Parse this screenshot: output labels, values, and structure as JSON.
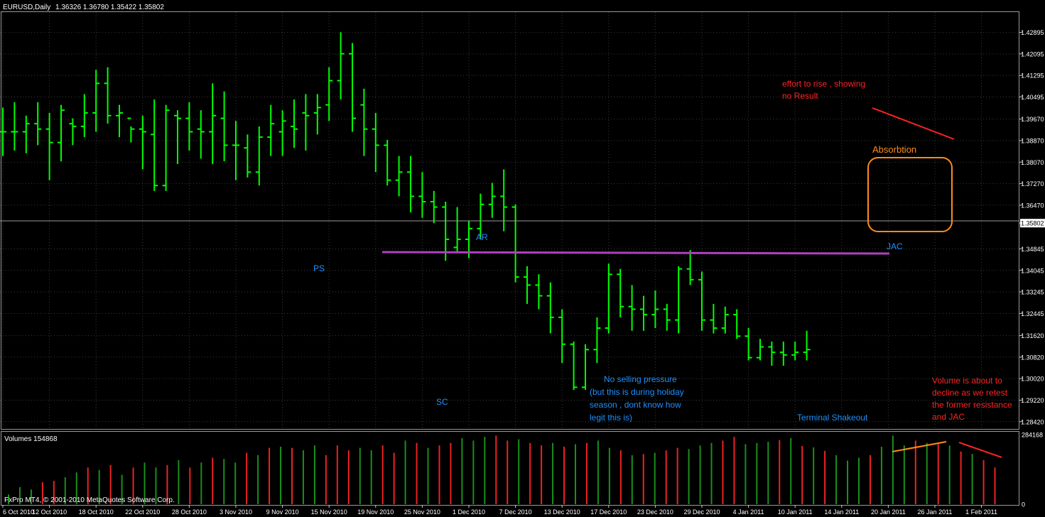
{
  "chart_data": {
    "type": "ohlc",
    "header": {
      "symbol": "EURUSD,Daily",
      "ohlc_text": "1.36326 1.36780 1.35422 1.35802"
    },
    "current_price_label": "1.35802",
    "price_axis": {
      "ylim": [
        1.2815,
        1.4365
      ],
      "ticks": [
        "1.42895",
        "1.42095",
        "1.41295",
        "1.40495",
        "1.39670",
        "1.38870",
        "1.38070",
        "1.37270",
        "1.36470",
        "1.35802",
        "1.34845",
        "1.34045",
        "1.33245",
        "1.32445",
        "1.31620",
        "1.30820",
        "1.30020",
        "1.29220",
        "1.28420"
      ]
    },
    "date_ticks": [
      {
        "index": 0,
        "label": "6 Oct 2010"
      },
      {
        "index": 4,
        "label": "12 Oct 2010"
      },
      {
        "index": 8,
        "label": "18 Oct 2010"
      },
      {
        "index": 12,
        "label": "22 Oct 2010"
      },
      {
        "index": 16,
        "label": "28 Oct 2010"
      },
      {
        "index": 20,
        "label": "3 Nov 2010"
      },
      {
        "index": 24,
        "label": "9 Nov 2010"
      },
      {
        "index": 28,
        "label": "15 Nov 2010"
      },
      {
        "index": 32,
        "label": "19 Nov 2010"
      },
      {
        "index": 36,
        "label": "25 Nov 2010"
      },
      {
        "index": 40,
        "label": "1 Dec 2010"
      },
      {
        "index": 44,
        "label": "7 Dec 2010"
      },
      {
        "index": 48,
        "label": "13 Dec 2010"
      },
      {
        "index": 52,
        "label": "17 Dec 2010"
      },
      {
        "index": 56,
        "label": "23 Dec 2010"
      },
      {
        "index": 60,
        "label": "29 Dec 2010"
      },
      {
        "index": 64,
        "label": "4 Jan 2011"
      },
      {
        "index": 68,
        "label": "10 Jan 2011"
      },
      {
        "index": 72,
        "label": "14 Jan 2011"
      },
      {
        "index": 76,
        "label": "20 Jan 2011"
      },
      {
        "index": 80,
        "label": "26 Jan 2011"
      },
      {
        "index": 84,
        "label": "1 Feb 2011"
      }
    ],
    "bars": [
      {
        "o": 1.392,
        "h": 1.401,
        "l": 1.383,
        "c": 1.392
      },
      {
        "o": 1.392,
        "h": 1.403,
        "l": 1.385,
        "c": 1.392
      },
      {
        "o": 1.392,
        "h": 1.398,
        "l": 1.384,
        "c": 1.395
      },
      {
        "o": 1.395,
        "h": 1.403,
        "l": 1.387,
        "c": 1.393
      },
      {
        "o": 1.393,
        "h": 1.399,
        "l": 1.374,
        "c": 1.388
      },
      {
        "o": 1.388,
        "h": 1.402,
        "l": 1.381,
        "c": 1.4
      },
      {
        "o": 1.395,
        "h": 1.397,
        "l": 1.387,
        "c": 1.394
      },
      {
        "o": 1.394,
        "h": 1.406,
        "l": 1.39,
        "c": 1.399
      },
      {
        "o": 1.399,
        "h": 1.415,
        "l": 1.392,
        "c": 1.41
      },
      {
        "o": 1.41,
        "h": 1.416,
        "l": 1.395,
        "c": 1.398
      },
      {
        "o": 1.398,
        "h": 1.402,
        "l": 1.39,
        "c": 1.399
      },
      {
        "o": 1.397,
        "h": 1.394,
        "l": 1.388,
        "c": 1.393
      },
      {
        "o": 1.393,
        "h": 1.398,
        "l": 1.378,
        "c": 1.392
      },
      {
        "o": 1.391,
        "h": 1.404,
        "l": 1.37,
        "c": 1.372
      },
      {
        "o": 1.372,
        "h": 1.402,
        "l": 1.37,
        "c": 1.4
      },
      {
        "o": 1.398,
        "h": 1.4,
        "l": 1.38,
        "c": 1.397
      },
      {
        "o": 1.397,
        "h": 1.403,
        "l": 1.385,
        "c": 1.392
      },
      {
        "o": 1.393,
        "h": 1.4,
        "l": 1.382,
        "c": 1.392
      },
      {
        "o": 1.392,
        "h": 1.41,
        "l": 1.38,
        "c": 1.398
      },
      {
        "o": 1.397,
        "h": 1.407,
        "l": 1.381,
        "c": 1.387
      },
      {
        "o": 1.387,
        "h": 1.396,
        "l": 1.374,
        "c": 1.387
      },
      {
        "o": 1.386,
        "h": 1.391,
        "l": 1.375,
        "c": 1.377
      },
      {
        "o": 1.377,
        "h": 1.394,
        "l": 1.372,
        "c": 1.39
      },
      {
        "o": 1.39,
        "h": 1.402,
        "l": 1.383,
        "c": 1.395
      },
      {
        "o": 1.392,
        "h": 1.4,
        "l": 1.383,
        "c": 1.396
      },
      {
        "o": 1.394,
        "h": 1.404,
        "l": 1.386,
        "c": 1.393
      },
      {
        "o": 1.399,
        "h": 1.406,
        "l": 1.385,
        "c": 1.398
      },
      {
        "o": 1.399,
        "h": 1.406,
        "l": 1.391,
        "c": 1.401
      },
      {
        "o": 1.402,
        "h": 1.416,
        "l": 1.396,
        "c": 1.411
      },
      {
        "o": 1.411,
        "h": 1.429,
        "l": 1.404,
        "c": 1.421
      },
      {
        "o": 1.421,
        "h": 1.425,
        "l": 1.392,
        "c": 1.397
      },
      {
        "o": 1.402,
        "h": 1.408,
        "l": 1.383,
        "c": 1.393
      },
      {
        "o": 1.393,
        "h": 1.399,
        "l": 1.377,
        "c": 1.387
      },
      {
        "o": 1.387,
        "h": 1.389,
        "l": 1.372,
        "c": 1.374
      },
      {
        "o": 1.374,
        "h": 1.383,
        "l": 1.368,
        "c": 1.377
      },
      {
        "o": 1.377,
        "h": 1.383,
        "l": 1.362,
        "c": 1.368
      },
      {
        "o": 1.368,
        "h": 1.377,
        "l": 1.36,
        "c": 1.366
      },
      {
        "o": 1.366,
        "h": 1.37,
        "l": 1.358,
        "c": 1.364
      },
      {
        "o": 1.364,
        "h": 1.366,
        "l": 1.344,
        "c": 1.352
      },
      {
        "o": 1.349,
        "h": 1.364,
        "l": 1.347,
        "c": 1.352
      },
      {
        "o": 1.352,
        "h": 1.359,
        "l": 1.345,
        "c": 1.356
      },
      {
        "o": 1.356,
        "h": 1.369,
        "l": 1.352,
        "c": 1.365
      },
      {
        "o": 1.365,
        "h": 1.373,
        "l": 1.36,
        "c": 1.368
      },
      {
        "o": 1.368,
        "h": 1.378,
        "l": 1.355,
        "c": 1.364
      },
      {
        "o": 1.364,
        "h": 1.365,
        "l": 1.336,
        "c": 1.338
      },
      {
        "o": 1.338,
        "h": 1.342,
        "l": 1.328,
        "c": 1.335
      },
      {
        "o": 1.335,
        "h": 1.339,
        "l": 1.326,
        "c": 1.331
      },
      {
        "o": 1.331,
        "h": 1.336,
        "l": 1.317,
        "c": 1.323
      },
      {
        "o": 1.323,
        "h": 1.326,
        "l": 1.306,
        "c": 1.313
      },
      {
        "o": 1.313,
        "h": 1.314,
        "l": 1.296,
        "c": 1.297
      },
      {
        "o": 1.297,
        "h": 1.313,
        "l": 1.296,
        "c": 1.311
      },
      {
        "o": 1.311,
        "h": 1.323,
        "l": 1.306,
        "c": 1.319
      },
      {
        "o": 1.319,
        "h": 1.343,
        "l": 1.317,
        "c": 1.339
      },
      {
        "o": 1.339,
        "h": 1.341,
        "l": 1.323,
        "c": 1.327
      },
      {
        "o": 1.327,
        "h": 1.335,
        "l": 1.318,
        "c": 1.326
      },
      {
        "o": 1.326,
        "h": 1.331,
        "l": 1.318,
        "c": 1.324
      },
      {
        "o": 1.324,
        "h": 1.333,
        "l": 1.319,
        "c": 1.326
      },
      {
        "o": 1.326,
        "h": 1.328,
        "l": 1.318,
        "c": 1.322
      },
      {
        "o": 1.322,
        "h": 1.342,
        "l": 1.317,
        "c": 1.341
      },
      {
        "o": 1.341,
        "h": 1.348,
        "l": 1.335,
        "c": 1.337
      },
      {
        "o": 1.337,
        "h": 1.34,
        "l": 1.318,
        "c": 1.322
      },
      {
        "o": 1.322,
        "h": 1.328,
        "l": 1.317,
        "c": 1.319
      },
      {
        "o": 1.319,
        "h": 1.327,
        "l": 1.317,
        "c": 1.324
      },
      {
        "o": 1.324,
        "h": 1.326,
        "l": 1.315,
        "c": 1.316
      },
      {
        "o": 1.316,
        "h": 1.319,
        "l": 1.307,
        "c": 1.308
      },
      {
        "o": 1.308,
        "h": 1.315,
        "l": 1.307,
        "c": 1.312
      },
      {
        "o": 1.312,
        "h": 1.314,
        "l": 1.305,
        "c": 1.31
      },
      {
        "o": 1.31,
        "h": 1.314,
        "l": 1.305,
        "c": 1.309
      },
      {
        "o": 1.309,
        "h": 1.314,
        "l": 1.307,
        "c": 1.31
      },
      {
        "o": 1.31,
        "h": 1.318,
        "l": 1.307,
        "c": 1.311
      }
    ],
    "volume": {
      "label": "Volumes 154868",
      "ylim": [
        0,
        284168
      ],
      "ticks": [
        "284168",
        "0"
      ],
      "values": [
        40000,
        70000,
        60000,
        90000,
        95000,
        110000,
        130000,
        150000,
        140000,
        160000,
        120000,
        150000,
        170000,
        150000,
        160000,
        180000,
        150000,
        170000,
        190000,
        185000,
        170000,
        210000,
        200000,
        230000,
        235000,
        230000,
        220000,
        240000,
        200000,
        240000,
        220000,
        230000,
        220000,
        240000,
        210000,
        260000,
        250000,
        230000,
        240000,
        250000,
        270000,
        260000,
        275000,
        280000,
        260000,
        265000,
        250000,
        240000,
        250000,
        235000,
        245000,
        250000,
        260000,
        230000,
        220000,
        200000,
        205000,
        210000,
        220000,
        230000,
        225000,
        240000,
        250000,
        260000,
        275000,
        245000,
        250000,
        255000,
        262000,
        270000,
        238000,
        232000,
        218000,
        200000,
        178000,
        190000,
        200000,
        235000,
        280000,
        240000,
        260000,
        250000,
        245000,
        240000,
        215000,
        205000,
        180000,
        150000
      ],
      "up": [
        true,
        true,
        true,
        false,
        false,
        true,
        true,
        false,
        true,
        false,
        true,
        false,
        true,
        true,
        false,
        true,
        false,
        true,
        false,
        true,
        true,
        false,
        true,
        false,
        true,
        false,
        true,
        true,
        false,
        false,
        false,
        true,
        true,
        false,
        false,
        true,
        false,
        true,
        false,
        false,
        true,
        true,
        true,
        false,
        false,
        true,
        false,
        false,
        true,
        false,
        true,
        false,
        true,
        true,
        false,
        true,
        false,
        true,
        false,
        false,
        true,
        true,
        true,
        false,
        false,
        true,
        true,
        true,
        false,
        true,
        false,
        true,
        false,
        true,
        true,
        true,
        false,
        true,
        true,
        true,
        false,
        true,
        false,
        true,
        false,
        true,
        false,
        false
      ]
    },
    "annotations": {
      "ps": "PS",
      "ar": "AR",
      "sc": "SC",
      "jac": "JAC",
      "absorbtion": "Absorbtion",
      "effort_line1": "effort to rise , showing",
      "effort_line2": "no Result",
      "noselling_line1": "No selling pressure",
      "noselling_line2": "(but this is during holiday",
      "noselling_line3": "season , dont know how",
      "noselling_line4": "legit this is)",
      "terminal": "Terminal Shakeout",
      "volume_line1": "Volume is about to",
      "volume_line2": "decline as we retest",
      "volume_line3": "the former resistance",
      "volume_line4": "and JAC"
    },
    "copyright": "FxPro MT4, © 2001-2010 MetaQuotes Software Corp."
  },
  "colors": {
    "background": "#000000",
    "bars": "#00ff00",
    "grid": "#3a3a3a",
    "axis_text": "#ffffff",
    "resistance_line": "#b040c0",
    "annotation_blue": "#1e90ff",
    "annotation_red": "#ff2222",
    "annotation_orange": "#ff8c1a",
    "volume_up": "#1a8f1a",
    "volume_down": "#ee2222"
  }
}
